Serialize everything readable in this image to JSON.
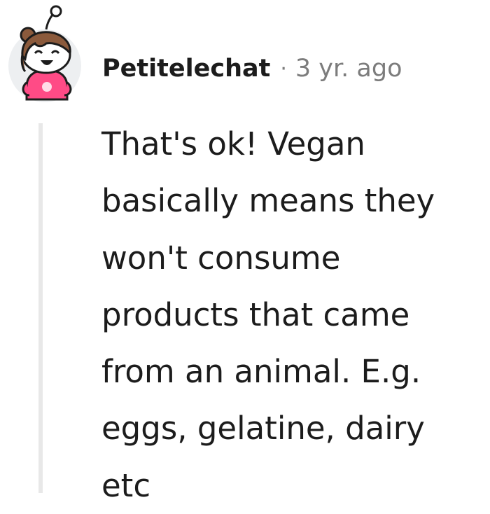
{
  "comment": {
    "author": "Petitelechat",
    "separator": "·",
    "timestamp": "3 yr. ago",
    "avatar_icon": "snoo-avatar-icon",
    "body_lines": [
      "That's ok! Vegan",
      "basically means they",
      "won't consume",
      "products that came",
      "from an animal. E.g.",
      "eggs, gelatine, dairy",
      "etc"
    ]
  },
  "colors": {
    "text": "#1c1c1c",
    "meta": "#7c7c7c",
    "thread_line": "#e8e8e8",
    "avatar_bg": "#edeff1",
    "hair": "#8b5a3c",
    "hoodie": "#ff4b86"
  }
}
